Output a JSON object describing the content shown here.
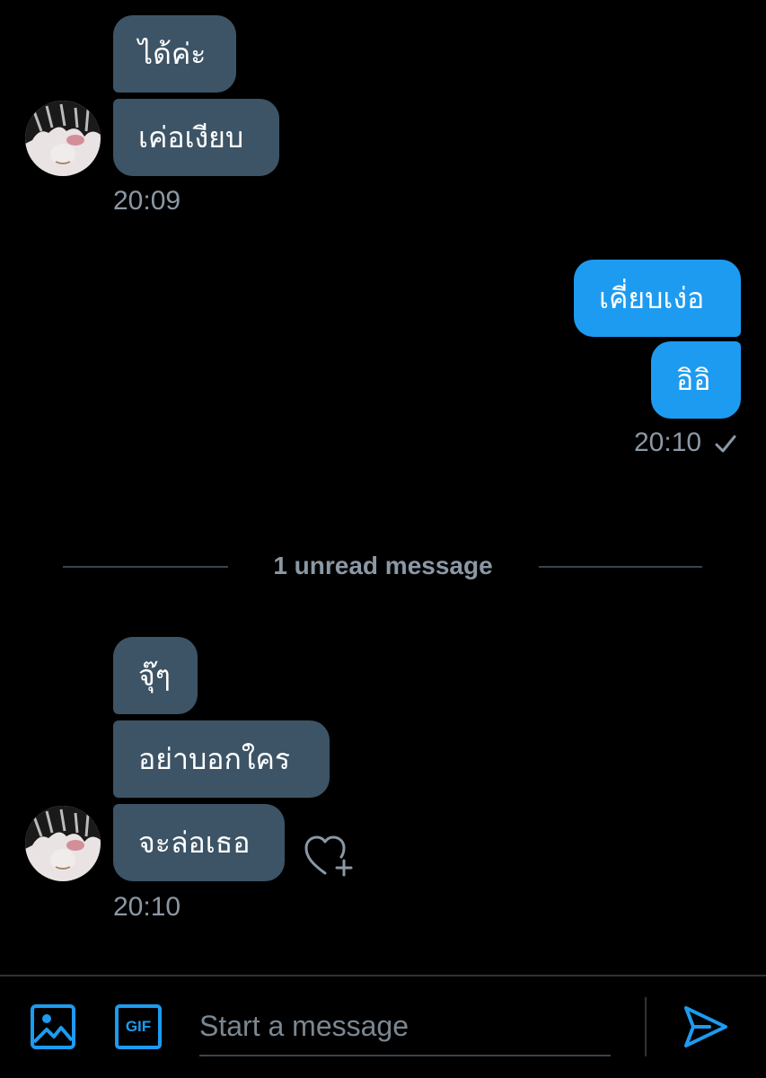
{
  "colors": {
    "background": "#000000",
    "incoming_bubble": "#3d5466",
    "outgoing_bubble": "#1d9bf0",
    "accent": "#1d9bf0",
    "muted_text": "#8b98a5"
  },
  "conversation": {
    "group1": {
      "messages": [
        "ได้ค่ะ",
        "เค่อเงียบ"
      ],
      "time": "20:09"
    },
    "group2": {
      "messages": [
        "เคี่ยบเง่อ",
        "อิอิ"
      ],
      "time": "20:10",
      "status_icon": "checkmark-icon"
    },
    "unread_divider": "1 unread message",
    "group3": {
      "messages": [
        "จุ๊ๆ",
        "อย่าบอกใคร",
        "จะล่อเธอ"
      ],
      "time": "20:10",
      "reaction_icon": "heart-plus-icon"
    }
  },
  "composer": {
    "placeholder": "Start a message",
    "image_icon": "image-icon",
    "gif_icon": "gif-icon",
    "gif_label": "GIF",
    "send_icon": "send-icon"
  }
}
